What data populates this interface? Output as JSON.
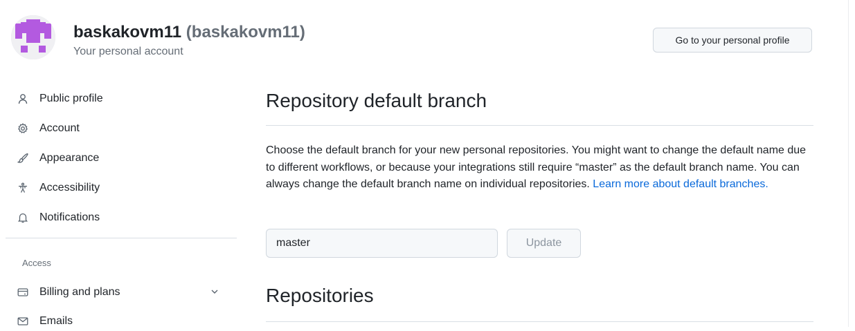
{
  "header": {
    "username": "baskakovm11",
    "login": "(baskakovm11)",
    "subtitle": "Your personal account",
    "profile_button": "Go to your personal profile"
  },
  "sidebar": {
    "items": [
      {
        "label": "Public profile",
        "icon": "person-icon"
      },
      {
        "label": "Account",
        "icon": "gear-icon"
      },
      {
        "label": "Appearance",
        "icon": "paintbrush-icon"
      },
      {
        "label": "Accessibility",
        "icon": "accessibility-icon"
      },
      {
        "label": "Notifications",
        "icon": "bell-icon"
      }
    ],
    "access_heading": "Access",
    "access_items": [
      {
        "label": "Billing and plans",
        "icon": "credit-card-icon",
        "expandable": true
      },
      {
        "label": "Emails",
        "icon": "mail-icon"
      }
    ]
  },
  "main": {
    "section_title": "Repository default branch",
    "description": "Choose the default branch for your new personal repositories. You might want to change the default name due to different workflows, or because your integrations still require “master” as the default branch name. You can always change the default branch name on individual repositories.",
    "learn_more": "Learn more about default branches.",
    "branch_input_value": "master",
    "update_button": "Update",
    "repositories_title": "Repositories"
  },
  "colors": {
    "link": "#0969da",
    "avatar": "#b35ae0",
    "border": "#d0d7de"
  }
}
